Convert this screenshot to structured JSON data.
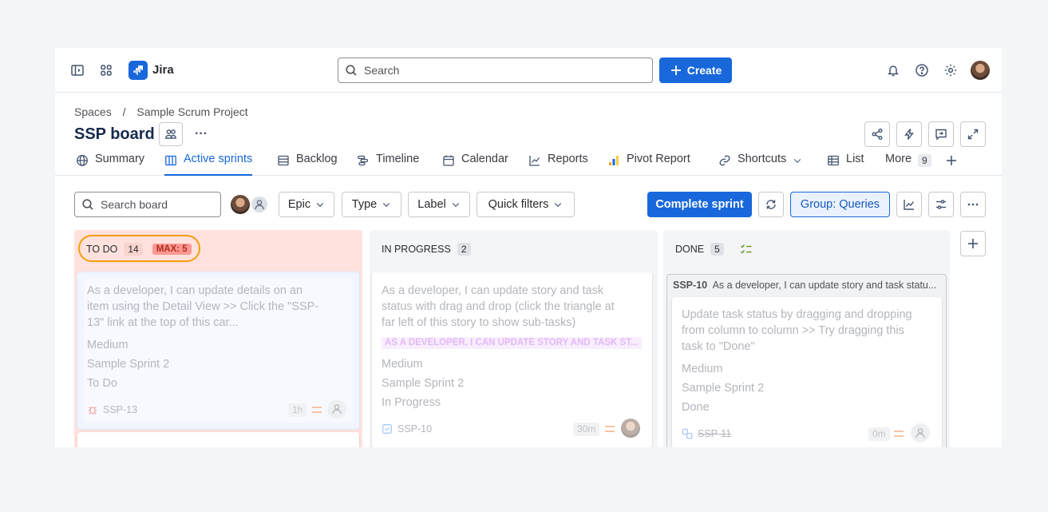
{
  "topbar": {
    "app_name": "Jira",
    "search_placeholder": "Search",
    "create_label": "Create"
  },
  "breadcrumb": {
    "root": "Spaces",
    "separator": "/",
    "project": "Sample Scrum Project"
  },
  "page": {
    "title": "SSP board",
    "more_label": "···"
  },
  "tabs": [
    {
      "label": "Summary",
      "icon": "globe-icon"
    },
    {
      "label": "Active sprints",
      "icon": "board-icon",
      "active": true
    },
    {
      "label": "Backlog",
      "icon": "backlog-icon"
    },
    {
      "label": "Timeline",
      "icon": "timeline-icon"
    },
    {
      "label": "Calendar",
      "icon": "calendar-icon"
    },
    {
      "label": "Reports",
      "icon": "chart-line-icon"
    },
    {
      "label": "Pivot Report",
      "icon": "pivot-report-icon"
    },
    {
      "label": "Shortcuts",
      "icon": "link-icon"
    },
    {
      "label": "List",
      "icon": "list-icon"
    },
    {
      "label": "More",
      "count": "9"
    }
  ],
  "toolbar": {
    "search_board_placeholder": "Search board",
    "filters": [
      "Epic",
      "Type",
      "Label",
      "Quick filters"
    ],
    "complete_sprint_label": "Complete sprint",
    "group_label": "Group: Queries"
  },
  "columns": [
    {
      "name": "TO DO",
      "count": "14",
      "max_label": "MAX: 5",
      "colors": {
        "bg": "#ffe2dd",
        "outline": "#f59e0b"
      },
      "cards": [
        {
          "summary": "As a developer, I can update details on an item using the Detail View >> Click the \"SSP-13\" link at the top of this car...",
          "priority": "Medium",
          "sprint": "Sample Sprint 2",
          "status": "To Do",
          "key": "SSP-13",
          "estimate": "1h",
          "type_icon": "bug-icon"
        }
      ]
    },
    {
      "name": "IN PROGRESS",
      "count": "2",
      "cards": [
        {
          "summary": "As a developer, I can update story and task status with drag and drop (click the triangle at far left of this story to show sub-tasks)",
          "parent_label": "AS A DEVELOPER, I CAN UPDATE STORY AND TASK ST...",
          "priority": "Medium",
          "sprint": "Sample Sprint 2",
          "status": "In Progress",
          "key": "SSP-10",
          "estimate": "30m",
          "type_icon": "story-check-icon"
        }
      ]
    },
    {
      "name": "DONE",
      "count": "5",
      "group_header": {
        "key": "SSP-10",
        "summary": "As a developer, I can update story and task statu..."
      },
      "cards": [
        {
          "summary": "Update task status by dragging and dropping from column to column >> Try dragging this task to \"Done\"",
          "priority": "Medium",
          "sprint": "Sample Sprint 2",
          "status": "Done",
          "key": "SSP-11",
          "estimate": "0m",
          "type_icon": "subtask-icon"
        }
      ]
    }
  ],
  "colors": {
    "accent": "#1868db",
    "todo_bg": "#ffe2dd",
    "max_badge_bg": "#fd9891",
    "max_badge_text": "#ae2e24",
    "column_bg": "#f4f5f7"
  }
}
